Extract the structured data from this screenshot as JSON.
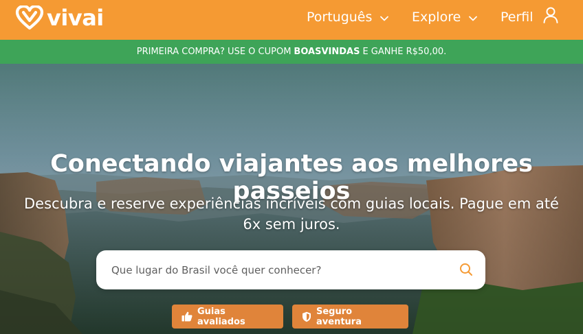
{
  "header": {
    "logo_text": "vivai",
    "nav": {
      "language": "Português",
      "explore": "Explore",
      "profile": "Perfil"
    }
  },
  "promo": {
    "prefix": "PRIMEIRA COMPRA? USE O CUPOM",
    "coupon": "BOASVINDAS",
    "suffix": "E GANHE R$50,00."
  },
  "hero": {
    "title": "Conectando viajantes aos melhores passeios",
    "subtitle": "Descubra e reserve experiências incríveis com guias locais. Pague em até 6x sem juros."
  },
  "search": {
    "placeholder": "Que lugar do Brasil você quer conhecer?"
  },
  "badges": {
    "guides": "Guias avaliados",
    "safety": "Seguro aventura"
  },
  "colors": {
    "header_bg": "#f59a33",
    "promo_bg": "#3ea458",
    "badge_bg": "#e0843a",
    "search_icon": "#f59a33"
  },
  "icons": {
    "logo": "heart-v-logo-icon",
    "language_chevron": "chevron-down-icon",
    "explore_chevron": "chevron-down-icon",
    "profile": "user-icon",
    "search": "search-icon",
    "guides": "thumbs-up-icon",
    "safety": "shield-icon"
  }
}
